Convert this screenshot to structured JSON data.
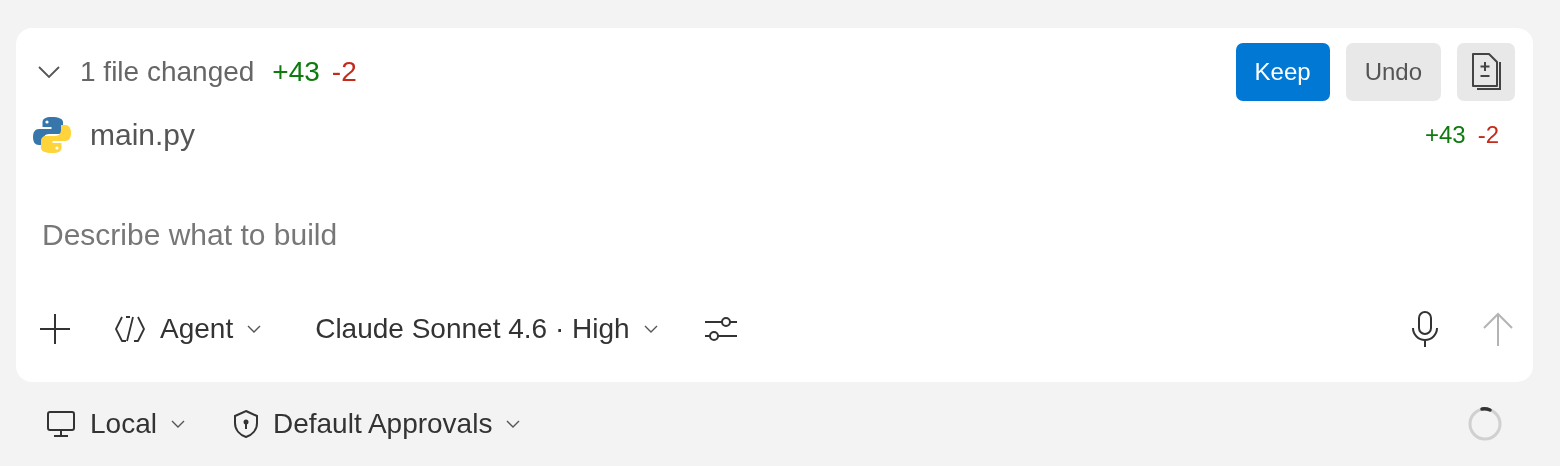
{
  "changes": {
    "expanded": true,
    "summary": "1 file changed",
    "added": "+43",
    "removed": "-2",
    "actions": [
      "Keep",
      "Undo"
    ]
  },
  "files": [
    {
      "name": "main.py",
      "added": "+43",
      "removed": "-2"
    }
  ],
  "prompt": {
    "placeholder": "Describe what to build"
  },
  "toolbar": {
    "mode": "Agent",
    "model": "Claude Sonnet 4.6 · High",
    "send_disabled": true
  },
  "footer": {
    "location": "Local",
    "approvals": "Default Approvals",
    "busy": true
  }
}
